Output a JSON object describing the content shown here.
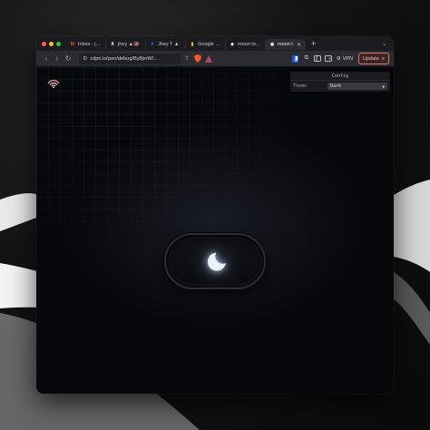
{
  "tabs": [
    {
      "label": "Inbox - jhey",
      "icon": "gmail-icon",
      "color": "#ea4335",
      "glyph": "M"
    },
    {
      "label": "jhey ▲🔞",
      "icon": "x-icon",
      "color": "#ffffff",
      "glyph": "X"
    },
    {
      "label": "Jhey T ▲",
      "icon": "bluesky-icon",
      "color": "#1185fe",
      "glyph": "✦"
    },
    {
      "label": "Google Keep",
      "icon": "keep-icon",
      "color": "#fbbc04",
      "glyph": "▮"
    },
    {
      "label": "moon toggle",
      "icon": "codepen-icon",
      "color": "#e8e8e8",
      "glyph": "◈"
    },
    {
      "label": "moon t",
      "icon": "codepen-icon",
      "color": "#e8e8e8",
      "glyph": "◉",
      "active": true
    }
  ],
  "toolbar": {
    "url": "cdpn.io/pen/debug/By8jxrW/...",
    "vpn_label": "VPN",
    "update_label": "Update"
  },
  "config_panel": {
    "title": "Config",
    "theme_label": "Theme",
    "theme_value": "Dark"
  },
  "colors": {
    "accent": "#e07a6a",
    "moon_glow": "#dbe8ff"
  }
}
